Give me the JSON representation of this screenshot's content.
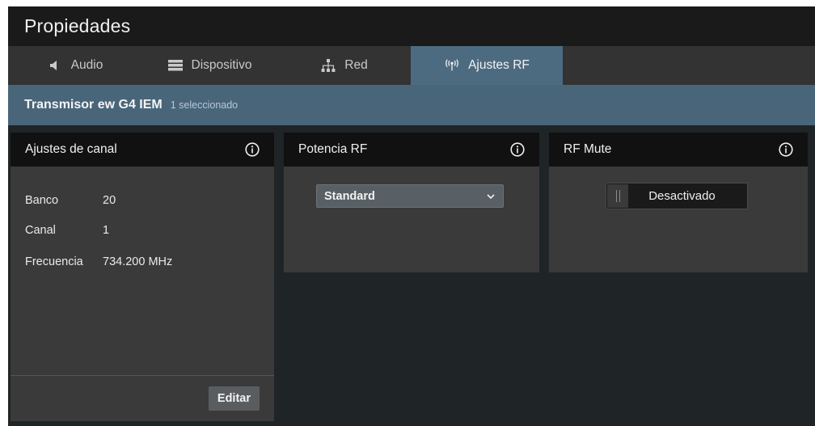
{
  "window": {
    "title": "Propiedades"
  },
  "tabs": [
    {
      "label": "Audio",
      "icon": "speaker-icon"
    },
    {
      "label": "Dispositivo",
      "icon": "device-icon"
    },
    {
      "label": "Red",
      "icon": "network-icon"
    },
    {
      "label": "Ajustes RF",
      "icon": "antenna-icon",
      "active": true
    }
  ],
  "device": {
    "name": "Transmisor ew G4 IEM",
    "selection": "1 seleccionado"
  },
  "panels": {
    "canal": {
      "title": "Ajustes de canal",
      "rows": [
        {
          "key": "Banco",
          "value": "20"
        },
        {
          "key": "Canal",
          "value": "1"
        },
        {
          "key": "Frecuencia",
          "value": "734.200 MHz"
        }
      ],
      "edit_label": "Editar"
    },
    "potencia": {
      "title": "Potencia RF",
      "selected": "Standard"
    },
    "mute": {
      "title": "RF Mute",
      "state_label": "Desactivado"
    }
  },
  "colors": {
    "accent_tab": "#4d6b80",
    "device_bar": "#49657a",
    "panel_bg": "#3a3a3a",
    "header_bg": "#111111"
  }
}
